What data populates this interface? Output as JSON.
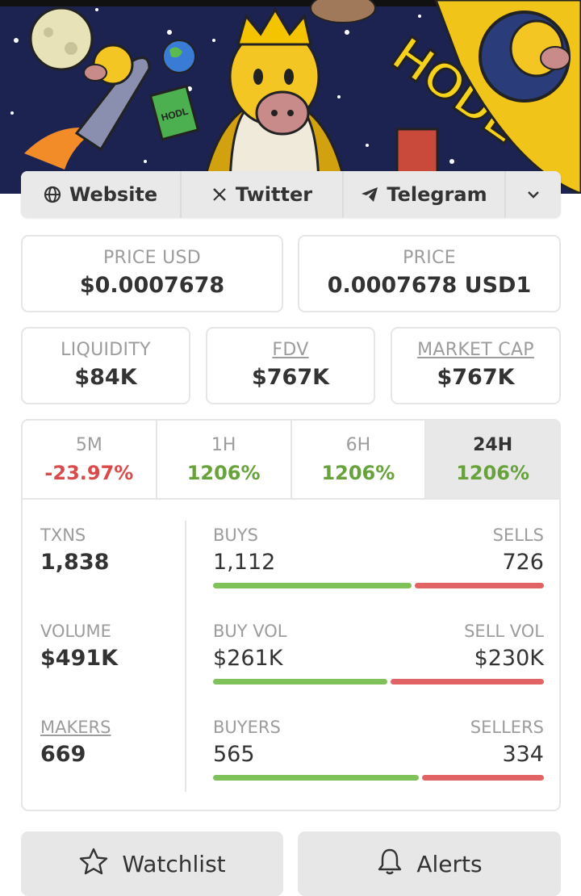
{
  "banner": {
    "text": "HODL",
    "book_text": "HODL"
  },
  "links": {
    "website": "Website",
    "twitter": "Twitter",
    "telegram": "Telegram"
  },
  "price": {
    "usd_label": "PRICE USD",
    "usd_value": "$0.0007678",
    "label": "PRICE",
    "value": "0.0007678 USD1"
  },
  "metrics": {
    "liquidity_label": "LIQUIDITY",
    "liquidity_value": "$84K",
    "fdv_label": "FDV",
    "fdv_value": "$767K",
    "mcap_label": "MARKET CAP",
    "mcap_value": "$767K"
  },
  "tabs": [
    {
      "label": "5M",
      "change": "-23.97%"
    },
    {
      "label": "1H",
      "change": "1206%"
    },
    {
      "label": "6H",
      "change": "1206%"
    },
    {
      "label": "24H",
      "change": "1206%"
    }
  ],
  "stats": {
    "txns_label": "TXNS",
    "txns_value": "1,838",
    "volume_label": "VOLUME",
    "volume_value": "$491K",
    "makers_label": "MAKERS",
    "makers_value": "669",
    "buys_label": "BUYS",
    "buys_value": "1,112",
    "sells_label": "SELLS",
    "sells_value": "726",
    "buyvol_label": "BUY VOL",
    "buyvol_value": "$261K",
    "sellvol_label": "SELL VOL",
    "sellvol_value": "$230K",
    "buyers_label": "BUYERS",
    "buyers_value": "565",
    "sellers_label": "SELLERS",
    "sellers_value": "334",
    "buys_ratio": 0.605,
    "buyvol_ratio": 0.532,
    "buyers_ratio": 0.628
  },
  "actions": {
    "watchlist": "Watchlist",
    "alerts": "Alerts"
  },
  "colors": {
    "positive": "#67a23a",
    "negative": "#d94a4a",
    "buy_bar": "#7fc25a",
    "sell_bar": "#e26363"
  }
}
